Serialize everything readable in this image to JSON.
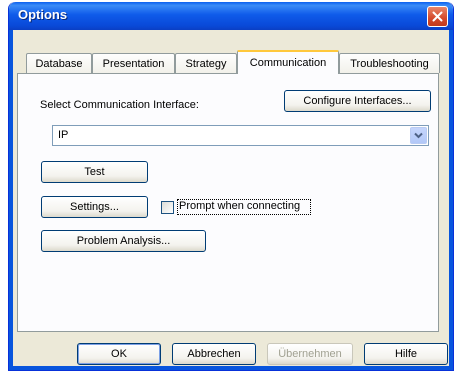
{
  "window": {
    "title": "Options"
  },
  "tabs": [
    {
      "label": "Database",
      "active": false
    },
    {
      "label": "Presentation",
      "active": false
    },
    {
      "label": "Strategy",
      "active": false
    },
    {
      "label": "Communication",
      "active": true
    },
    {
      "label": "Troubleshooting",
      "active": false
    }
  ],
  "communication": {
    "select_label": "Select Communication Interface:",
    "configure_button": "Configure Interfaces...",
    "interface_value": "IP",
    "test_button": "Test",
    "settings_button": "Settings...",
    "prompt_checkbox_label": "Prompt when connecting",
    "prompt_checked": false,
    "problem_button": "Problem Analysis..."
  },
  "footer": {
    "ok": "OK",
    "cancel": "Abbrechen",
    "apply": "Übernehmen",
    "help": "Hilfe"
  },
  "icons": {
    "close": "close-icon",
    "dropdown": "chevron-down-icon"
  },
  "colors": {
    "titlebar": "#0a5fef",
    "close": "#d4492b",
    "dialog_bg": "#ece9d8",
    "active_tab_highlight": "#ffc83c"
  }
}
